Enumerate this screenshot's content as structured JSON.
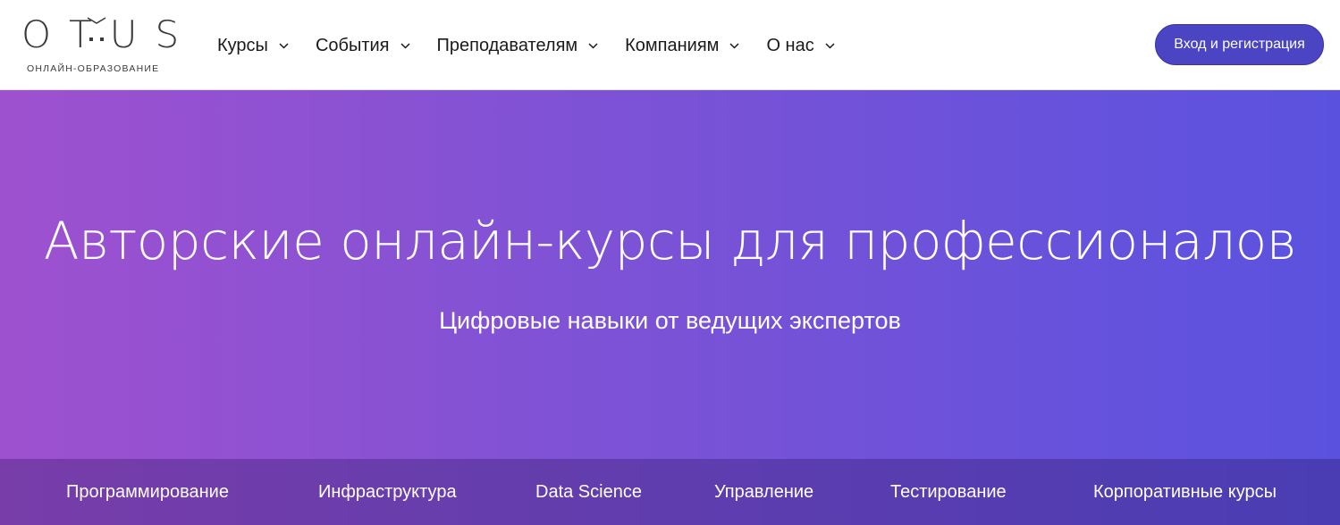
{
  "logo": {
    "word": "OTUS",
    "subtitle": "ОНЛАЙН-ОБРАЗОВАНИЕ"
  },
  "nav": {
    "items": [
      {
        "label": "Курсы"
      },
      {
        "label": "События"
      },
      {
        "label": "Преподавателям"
      },
      {
        "label": "Компаниям"
      },
      {
        "label": "О нас"
      }
    ]
  },
  "header": {
    "login_label": "Вход и регистрация"
  },
  "hero": {
    "title": "Авторские онлайн-курсы для профессионалов",
    "subtitle": "Цифровые навыки от ведущих экспертов"
  },
  "categories": {
    "items": [
      {
        "label": "Программирование"
      },
      {
        "label": "Инфраструктура"
      },
      {
        "label": "Data Science"
      },
      {
        "label": "Управление"
      },
      {
        "label": "Тестирование"
      },
      {
        "label": "Корпоративные курсы"
      }
    ]
  },
  "colors": {
    "accent": "#4b45c4",
    "gradient_start": "#9e51cf",
    "gradient_end": "#5a52df"
  },
  "icons": {
    "nav_dropdown": "chevron-down-icon"
  }
}
